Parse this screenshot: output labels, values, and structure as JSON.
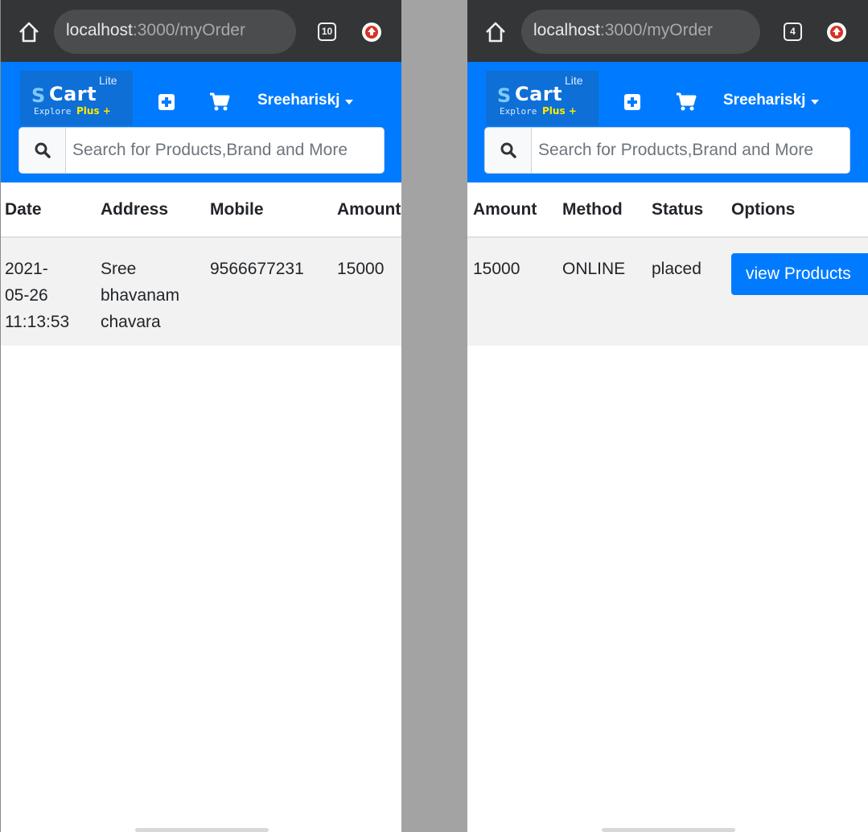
{
  "screens": [
    {
      "browser": {
        "url_host": "localhost",
        "url_path": ":3000/myOrder",
        "tab_count": "10"
      },
      "navbar": {
        "logo": {
          "s": "S",
          "cart": "Cart",
          "lite": "Lite",
          "explore": "Explore",
          "plus": "Plus +"
        },
        "username": "Sreehariskj",
        "search_placeholder": "Search for Products,Brand and More"
      },
      "table": {
        "headers": [
          "Date",
          "Address",
          "Mobile",
          "Amount"
        ],
        "row": {
          "date": [
            "2021-",
            "05-26",
            "11:13:53"
          ],
          "address": [
            "Sree",
            "bhavanam",
            "chavara"
          ],
          "mobile": "9566677231",
          "amount": "15000"
        }
      }
    },
    {
      "browser": {
        "url_host": "localhost",
        "url_path": ":3000/myOrder",
        "tab_count": "4"
      },
      "navbar": {
        "logo": {
          "s": "S",
          "cart": "Cart",
          "lite": "Lite",
          "explore": "Explore",
          "plus": "Plus +"
        },
        "username": "Sreehariskj",
        "search_placeholder": "Search for Products,Brand and More"
      },
      "table": {
        "headers": [
          "Amount",
          "Method",
          "Status",
          "Options"
        ],
        "row": {
          "amount": "15000",
          "method": "ONLINE",
          "status": "placed",
          "option_button": "view Products"
        }
      }
    }
  ],
  "colors": {
    "browser_bar": "#333536",
    "navbar": "#007bff",
    "button": "#007bff",
    "row_stripe": "#f2f2f2",
    "divider": "#a3a3a3"
  }
}
